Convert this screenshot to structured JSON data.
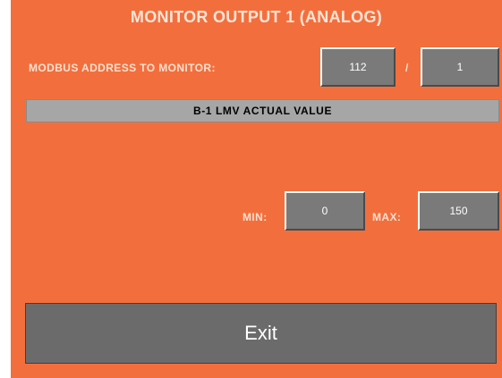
{
  "screen": {
    "title": "MONITOR OUTPUT 1 (ANALOG)"
  },
  "modbus": {
    "label": "MODBUS ADDRESS TO MONITOR:",
    "address_value": "112",
    "separator": "/",
    "sub_value": "1"
  },
  "parameter_bar": {
    "text": "B-1 LMV ACTUAL VALUE"
  },
  "range": {
    "min_label": "MIN:",
    "min_value": "0",
    "max_label": "MAX:",
    "max_value": "150"
  },
  "actions": {
    "exit_label": "Exit"
  },
  "colors": {
    "background": "#f26f3d",
    "field": "#7a7a7a",
    "bar": "#a6a6a6",
    "button": "#6b6b6b"
  }
}
